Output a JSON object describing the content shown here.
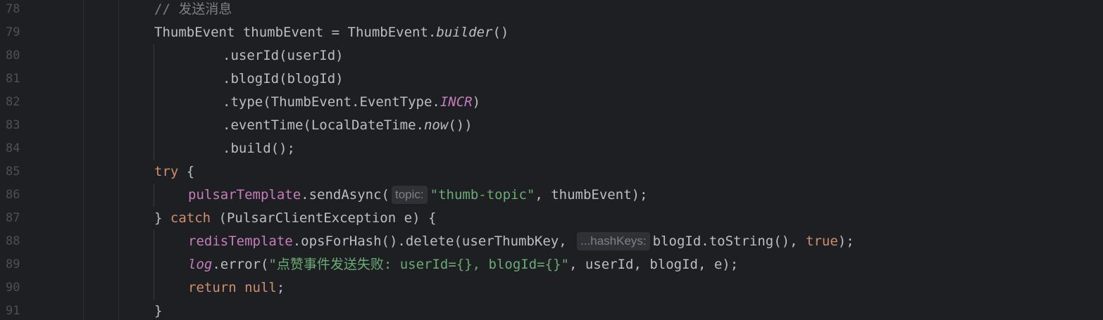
{
  "editor": {
    "lines": [
      {
        "num": "78",
        "parts": [
          {
            "t": "// 发送消息",
            "c": "comment"
          }
        ]
      },
      {
        "num": "79",
        "parts": [
          {
            "t": "ThumbEvent thumbEvent = ThumbEvent.",
            "c": "plain"
          },
          {
            "t": "builder",
            "c": "italic"
          },
          {
            "t": "()",
            "c": "plain"
          }
        ]
      },
      {
        "num": "80",
        "parts": [
          {
            "t": ".userId(userId)",
            "c": "plain"
          }
        ]
      },
      {
        "num": "81",
        "parts": [
          {
            "t": ".blogId(blogId)",
            "c": "plain"
          }
        ]
      },
      {
        "num": "82",
        "parts": [
          {
            "t": ".type(ThumbEvent.EventType.",
            "c": "plain"
          },
          {
            "t": "INCR",
            "c": "const"
          },
          {
            "t": ")",
            "c": "plain"
          }
        ]
      },
      {
        "num": "83",
        "parts": [
          {
            "t": ".eventTime(LocalDateTime.",
            "c": "plain"
          },
          {
            "t": "now",
            "c": "italic"
          },
          {
            "t": "())",
            "c": "plain"
          }
        ]
      },
      {
        "num": "84",
        "parts": [
          {
            "t": ".build();",
            "c": "plain"
          }
        ]
      },
      {
        "num": "85",
        "parts": [
          {
            "t": "try",
            "c": "kw"
          },
          {
            "t": " {",
            "c": "plain"
          }
        ]
      },
      {
        "num": "86",
        "parts": [
          {
            "t": "pulsarTemplate",
            "c": "field"
          },
          {
            "t": ".sendAsync(",
            "c": "plain"
          },
          {
            "t": "topic:",
            "c": "hint"
          },
          {
            "t": "\"thumb-topic\"",
            "c": "str"
          },
          {
            "t": ", thumbEvent);",
            "c": "plain"
          }
        ]
      },
      {
        "num": "87",
        "parts": [
          {
            "t": "} ",
            "c": "plain"
          },
          {
            "t": "catch",
            "c": "kw"
          },
          {
            "t": " (PulsarClientException e) {",
            "c": "plain"
          }
        ]
      },
      {
        "num": "88",
        "parts": [
          {
            "t": "redisTemplate",
            "c": "field"
          },
          {
            "t": ".opsForHash().delete(userThumbKey, ",
            "c": "plain"
          },
          {
            "t": "...hashKeys:",
            "c": "hint"
          },
          {
            "t": "blogId.toString(), ",
            "c": "plain"
          },
          {
            "t": "true",
            "c": "kw"
          },
          {
            "t": ");",
            "c": "plain"
          }
        ]
      },
      {
        "num": "89",
        "parts": [
          {
            "t": "log",
            "c": "static"
          },
          {
            "t": ".error(",
            "c": "plain"
          },
          {
            "t": "\"点赞事件发送失败: userId={}, blogId={}\"",
            "c": "str"
          },
          {
            "t": ", userId, blogId, e);",
            "c": "plain"
          }
        ]
      },
      {
        "num": "90",
        "parts": [
          {
            "t": "return",
            "c": "kw"
          },
          {
            "t": " ",
            "c": "plain"
          },
          {
            "t": "null",
            "c": "kw"
          },
          {
            "t": ";",
            "c": "plain"
          }
        ]
      },
      {
        "num": "91",
        "parts": [
          {
            "t": "}",
            "c": "plain"
          }
        ]
      }
    ]
  }
}
